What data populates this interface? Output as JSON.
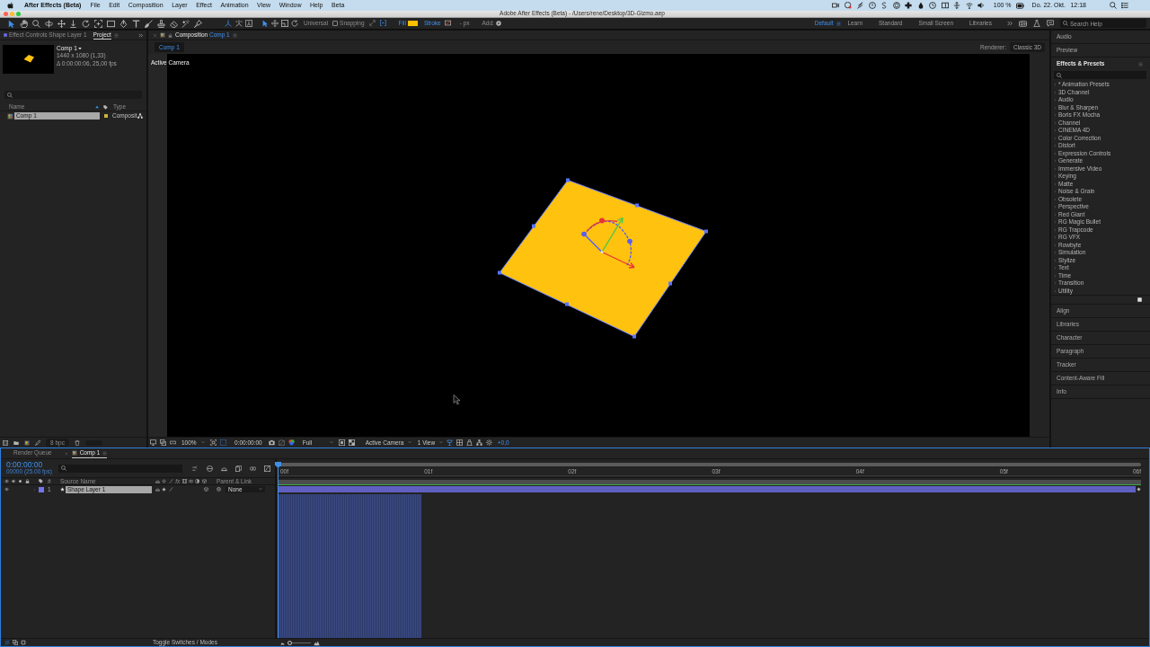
{
  "menubar": {
    "app_name": "After Effects (Beta)",
    "menus": [
      "File",
      "Edit",
      "Composition",
      "Layer",
      "Effect",
      "Animation",
      "View",
      "Window",
      "Help",
      "Beta"
    ],
    "battery": "100 %",
    "date": "Do. 22. Okt.",
    "time": "12:18"
  },
  "window": {
    "title": "Adobe After Effects (Beta) - /Users/rene/Desktop/3D-Gizmo.aep"
  },
  "toolbar": {
    "axis_mode": "Universal",
    "snapping": {
      "label": "Snapping",
      "checked": false
    },
    "fill": {
      "label": "Fill",
      "color": "#ffc000"
    },
    "stroke": {
      "label": "Stroke",
      "width": "- px"
    },
    "add_label": "Add:"
  },
  "workspaces": [
    {
      "label": "Default",
      "selected": true
    },
    {
      "label": "Learn",
      "selected": false
    },
    {
      "label": "Standard",
      "selected": false
    },
    {
      "label": "Small Screen",
      "selected": false
    },
    {
      "label": "Libraries",
      "selected": false
    }
  ],
  "help_search": {
    "placeholder": "Search Help"
  },
  "project_panel": {
    "tabs": [
      {
        "label": "Effect Controls Shape Layer 1",
        "kind": "effect_controls",
        "selected": false
      },
      {
        "label": "Project",
        "kind": "project",
        "selected": true
      }
    ],
    "preview": {
      "name": "Comp 1",
      "details": [
        "1440 x 1080 (1,33)",
        "Δ 0:00:00:06, 25,00 fps"
      ]
    },
    "columns": [
      "Name",
      "Type"
    ],
    "items": [
      {
        "name": "Comp 1",
        "type": "Composit",
        "selected": true,
        "color": "#c9b53d"
      }
    ],
    "bit_depth": "8 bpc"
  },
  "composition_panel": {
    "tab_label": "Composition",
    "tab_comp": "Comp 1",
    "breadcrumb": "Comp 1",
    "renderer_label": "Renderer:",
    "renderer": "Classic 3D",
    "camera_label": "Active Camera",
    "controls": {
      "zoom": "100%",
      "timecode": "0:00:00:00",
      "resolution": "Full",
      "camera": "Active Camera",
      "views": "1 View",
      "exposure": "+0,0"
    }
  },
  "right_panels": {
    "top": [
      "Audio",
      "Preview"
    ],
    "effects": {
      "title": "Effects & Presets",
      "categories": [
        {
          "label": "* Animation Presets",
          "expanded": false
        },
        {
          "label": "3D Channel",
          "expanded": false
        },
        {
          "label": "Audio",
          "expanded": false
        },
        {
          "label": "Blur & Sharpen",
          "expanded": false
        },
        {
          "label": "Boris FX Mocha",
          "expanded": false
        },
        {
          "label": "Channel",
          "expanded": false
        },
        {
          "label": "CINEMA 4D",
          "expanded": false
        },
        {
          "label": "Color Correction",
          "expanded": false
        },
        {
          "label": "Distort",
          "expanded": false
        },
        {
          "label": "Expression Controls",
          "expanded": false
        },
        {
          "label": "Generate",
          "expanded": false
        },
        {
          "label": "Immersive Video",
          "expanded": false
        },
        {
          "label": "Keying",
          "expanded": false
        },
        {
          "label": "Matte",
          "expanded": false
        },
        {
          "label": "Noise & Grain",
          "expanded": false
        },
        {
          "label": "Obsolete",
          "expanded": false
        },
        {
          "label": "Perspective",
          "expanded": false
        },
        {
          "label": "Red Giant",
          "expanded": false
        },
        {
          "label": "RG Magic Bullet",
          "expanded": false
        },
        {
          "label": "RG Trapcode",
          "expanded": false
        },
        {
          "label": "RG VFX",
          "expanded": false
        },
        {
          "label": "Rowbyte",
          "expanded": false
        },
        {
          "label": "Simulation",
          "expanded": false
        },
        {
          "label": "Stylize",
          "expanded": false
        },
        {
          "label": "Text",
          "expanded": false
        },
        {
          "label": "Time",
          "expanded": false
        },
        {
          "label": "Transition",
          "expanded": false
        },
        {
          "label": "Utility",
          "expanded": false
        }
      ]
    },
    "bottom": [
      "Align",
      "Libraries",
      "Character",
      "Paragraph",
      "Tracker",
      "Content-Aware Fill",
      "Info"
    ]
  },
  "timeline": {
    "tabs": [
      {
        "label": "Render Queue",
        "kind": "render_queue",
        "selected": false
      },
      {
        "label": "Comp 1",
        "kind": "composition",
        "selected": true
      }
    ],
    "current_time": "0:00:00:00",
    "frame_info": "00000 (25.00 fps)",
    "columns": {
      "number": "#",
      "source": "Source Name",
      "effects": "fx",
      "parent": "Parent & Link"
    },
    "ruler": [
      "00f",
      "01f",
      "02f",
      "03f",
      "04f",
      "05f",
      "06f"
    ],
    "layers": [
      {
        "number": "1",
        "name": "Shape Layer 1",
        "visible": true,
        "expanded": false,
        "selected": true,
        "color": "#7474ec",
        "parent": "None"
      }
    ],
    "toggle_label": "Toggle Switches / Modes",
    "zoom_slider": {
      "level": 0.1
    }
  }
}
